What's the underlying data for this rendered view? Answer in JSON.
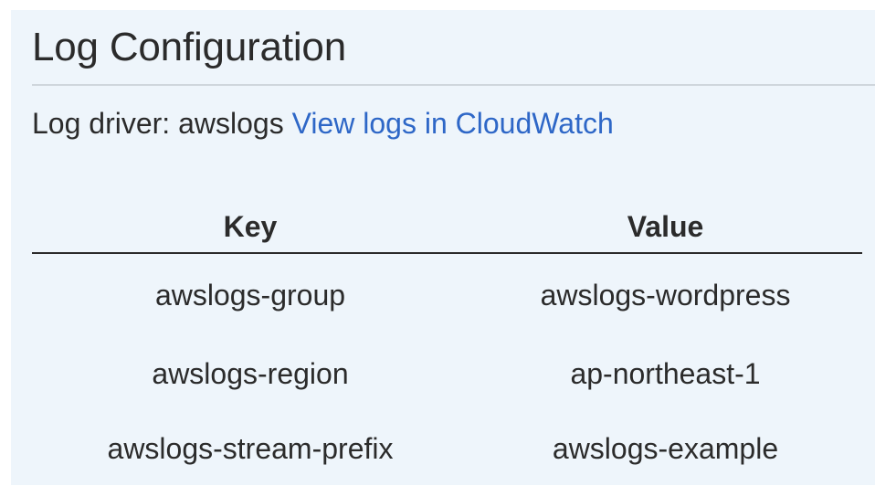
{
  "section": {
    "title": "Log Configuration"
  },
  "log_driver": {
    "label": "Log driver: awslogs",
    "link_text": "View logs in CloudWatch"
  },
  "options_table": {
    "headers": {
      "key": "Key",
      "value": "Value"
    },
    "rows": [
      {
        "key": "awslogs-group",
        "value": "awslogs-wordpress"
      },
      {
        "key": "awslogs-region",
        "value": "ap-northeast-1"
      },
      {
        "key": "awslogs-stream-prefix",
        "value": "awslogs-example"
      }
    ]
  },
  "colors": {
    "panel_background": "#eef5fb",
    "link": "#2e67c7",
    "text": "#2b2b2b",
    "divider": "#cfd6dc"
  }
}
